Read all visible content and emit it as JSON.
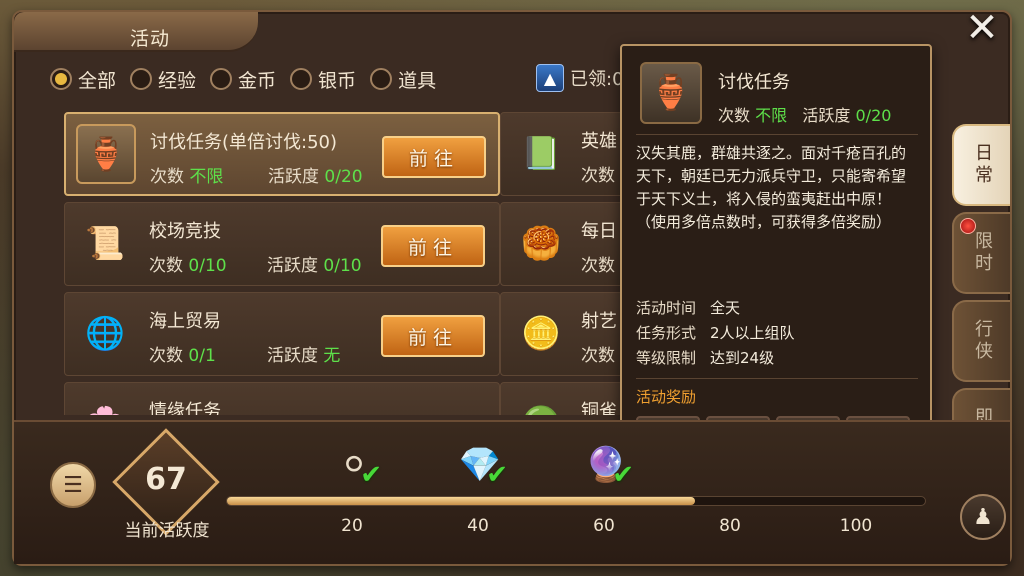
{
  "window": {
    "title": "活动",
    "close_icon": "✕"
  },
  "filters": [
    {
      "label": "全部",
      "selected": true
    },
    {
      "label": "经验",
      "selected": false
    },
    {
      "label": "金币",
      "selected": false
    },
    {
      "label": "银币",
      "selected": false
    },
    {
      "label": "道具",
      "selected": false
    }
  ],
  "claimed": {
    "label": "已领:0"
  },
  "tasks": [
    {
      "name": "讨伐任务(单倍讨伐:50)",
      "count_label": "次数",
      "count_value": "不限",
      "active_label": "活跃度",
      "active_value": "0/20",
      "button": "前往",
      "icon": "🏺",
      "selected": true
    },
    {
      "name": "校场竞技",
      "count_label": "次数",
      "count_value": "0/10",
      "active_label": "活跃度",
      "active_value": "0/10",
      "button": "前往",
      "icon": "📜",
      "selected": false
    },
    {
      "name": "海上贸易",
      "count_label": "次数",
      "count_value": "0/1",
      "active_label": "活跃度",
      "active_value": "无",
      "button": "前往",
      "icon": "🌐",
      "selected": false
    },
    {
      "name": "情缘任务",
      "icon": "🌸",
      "selected": false
    }
  ],
  "right_tasks": [
    {
      "name": "英雄",
      "count_label": "次数",
      "icon": "📗"
    },
    {
      "name": "每日",
      "count_label": "次数",
      "icon": "🥮"
    },
    {
      "name": "射艺",
      "count_label": "次数",
      "icon": "🪙"
    },
    {
      "name": "铜雀",
      "icon": "🟢"
    }
  ],
  "tooltip": {
    "title": "讨伐任务",
    "count_label": "次数",
    "count_value": "不限",
    "active_label": "活跃度",
    "active_value": "0/20",
    "description": "汉失其鹿，群雄共逐之。面对千疮百孔的天下，朝廷已无力派兵守卫，只能寄希望于天下义士，将入侵的蛮夷赶出中原！（使用多倍点数时，可获得多倍奖励）",
    "info": [
      {
        "label": "活动时间",
        "value": "全天"
      },
      {
        "label": "任务形式",
        "value": "2人以上组队"
      },
      {
        "label": "等级限制",
        "value": "达到24级"
      }
    ],
    "reward_title": "活动奖励",
    "rewards": [
      "📘",
      "🪙",
      "🏺",
      "🎖️"
    ]
  },
  "side_tabs": [
    {
      "label": "日常",
      "active": true,
      "dot": false
    },
    {
      "label": "限时",
      "active": false,
      "dot": true
    },
    {
      "label": "行侠",
      "active": false,
      "dot": false
    },
    {
      "label": "即将",
      "active": false,
      "dot": false
    }
  ],
  "activity": {
    "value": "67",
    "label": "当前活跃度",
    "progress_fraction": 0.67,
    "milestones": [
      {
        "value": "20",
        "icon": "⚪",
        "done": true
      },
      {
        "value": "40",
        "icon": "💎",
        "done": true
      },
      {
        "value": "60",
        "icon": "🔮",
        "done": true
      },
      {
        "value": "80",
        "icon": "",
        "done": false
      },
      {
        "value": "100",
        "icon": "",
        "done": false
      }
    ]
  },
  "colors": {
    "accent": "#f0a040",
    "green": "#5ee04a",
    "reward_title": "#f0a030"
  }
}
